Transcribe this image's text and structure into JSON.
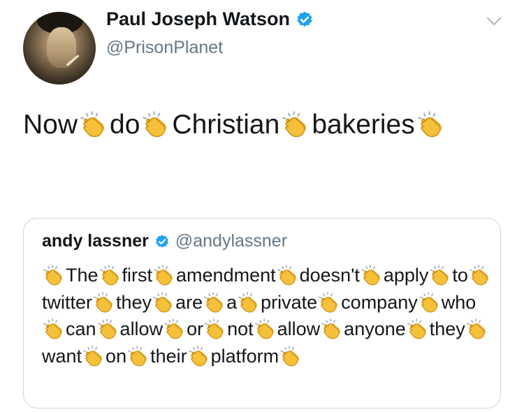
{
  "tweet": {
    "author": {
      "display_name": "Paul Joseph Watson",
      "handle": "@PrisonPlanet",
      "verified": true
    },
    "text_parts": [
      "Now",
      "do",
      "Christian",
      "bakeries"
    ],
    "clap_emoji": "👏"
  },
  "quoted_tweet": {
    "author": {
      "display_name": "andy lassner",
      "handle": "@andylassner",
      "verified": true
    },
    "words": [
      "The",
      "first",
      "amendment",
      "doesn't",
      "apply",
      "to",
      "twitter",
      "they",
      "are",
      "a",
      "private",
      "company",
      "who",
      "can",
      "allow",
      "or",
      "not",
      "allow",
      "anyone",
      "they",
      "want",
      "on",
      "their",
      "platform"
    ]
  },
  "colors": {
    "verified_blue": "#1da1f2",
    "handle_gray": "#657786",
    "border": "#ccd6dd",
    "clap_yellow": "#f6c13a"
  },
  "icons": {
    "verified": "verified-badge-icon",
    "caret": "chevron-down-icon",
    "clap": "clapping-hands-icon"
  }
}
